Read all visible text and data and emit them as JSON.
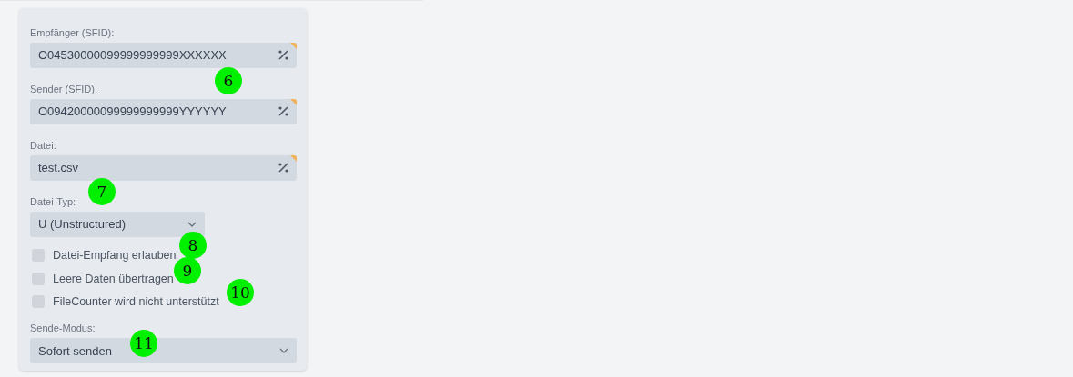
{
  "form": {
    "fields": [
      {
        "kind": "text",
        "label": "Empfänger (SFID):",
        "value": "O04530000099999999999XXXXXX"
      },
      {
        "kind": "text",
        "label": "Sender (SFID):",
        "value": "O09420000099999999999YYYYYY"
      },
      {
        "kind": "text",
        "label": "Datei:",
        "value": "test.csv"
      },
      {
        "kind": "select",
        "label": "Datei-Typ:",
        "value": "U (Unstructured)"
      },
      {
        "kind": "checkbox",
        "label": "Datei-Empfang erlauben",
        "checked": false
      },
      {
        "kind": "checkbox",
        "label": "Leere Daten übertragen",
        "checked": false
      },
      {
        "kind": "checkbox",
        "label": "FileCounter wird nicht unterstützt",
        "checked": false
      },
      {
        "kind": "select-wide",
        "label": "Sende-Modus:",
        "value": "Sofort senden"
      }
    ]
  },
  "callouts": [
    {
      "label": "6"
    },
    {
      "label": "7"
    },
    {
      "label": "8"
    },
    {
      "label": "9"
    },
    {
      "label": "10"
    },
    {
      "label": "11"
    }
  ]
}
